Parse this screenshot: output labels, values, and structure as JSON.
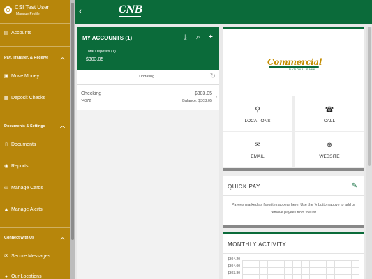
{
  "user": {
    "avatar_glyph": "⊙",
    "name": "CSI Test User",
    "manage": "Manage Profile"
  },
  "sidebar": {
    "accounts": {
      "label": "Accounts",
      "icon": "accounts-icon"
    },
    "section_pay": "Pay, Transfer, & Receive",
    "move_money": {
      "label": "Move Money",
      "icon": "move-money-icon"
    },
    "deposit_checks": {
      "label": "Deposit Checks",
      "icon": "deposit-checks-icon"
    },
    "section_docs": "Documents & Settings",
    "documents": {
      "label": "Documents",
      "icon": "documents-icon"
    },
    "reports": {
      "label": "Reports",
      "icon": "reports-icon"
    },
    "manage_cards": {
      "label": "Manage Cards",
      "icon": "manage-cards-icon"
    },
    "manage_alerts": {
      "label": "Manage Alerts",
      "icon": "manage-alerts-icon"
    },
    "section_connect": "Connect with Us",
    "secure_messages": {
      "label": "Secure Messages",
      "icon": "secure-messages-icon"
    },
    "our_locations": {
      "label": "Our Locations",
      "icon": "locations-icon"
    }
  },
  "topbar": {
    "back_glyph": "‹",
    "logo_text": "CNB",
    "color": "#0b6b3a"
  },
  "accounts_panel": {
    "title": "MY ACCOUNTS (1)",
    "total_label": "Total Deposits (1)",
    "total_value": "$303.05",
    "updating": "Updating...",
    "account": {
      "name": "Checking",
      "number": "*4072",
      "amount": "$303.05",
      "balance": "Balance: $303.05"
    }
  },
  "bank": {
    "name": "Commercial",
    "subtitle": "NATIONAL BANK",
    "brand_color": "#c48d00"
  },
  "tiles": {
    "locations": {
      "label": "LOCATIONS",
      "icon": "location-pin-icon"
    },
    "call": {
      "label": "CALL",
      "icon": "phone-icon"
    },
    "email": {
      "label": "EMAIL",
      "icon": "email-icon"
    },
    "website": {
      "label": "WEBSITE",
      "icon": "globe-icon"
    }
  },
  "quick_pay": {
    "title": "QUICK PAY",
    "message": "Payees marked as favorites appear here. Use the ✎ button above to add or remove payees from the list"
  },
  "monthly": {
    "title": "MONTHLY ACTIVITY",
    "y_ticks": [
      "$304.20",
      "$304.00",
      "$303.80"
    ]
  }
}
